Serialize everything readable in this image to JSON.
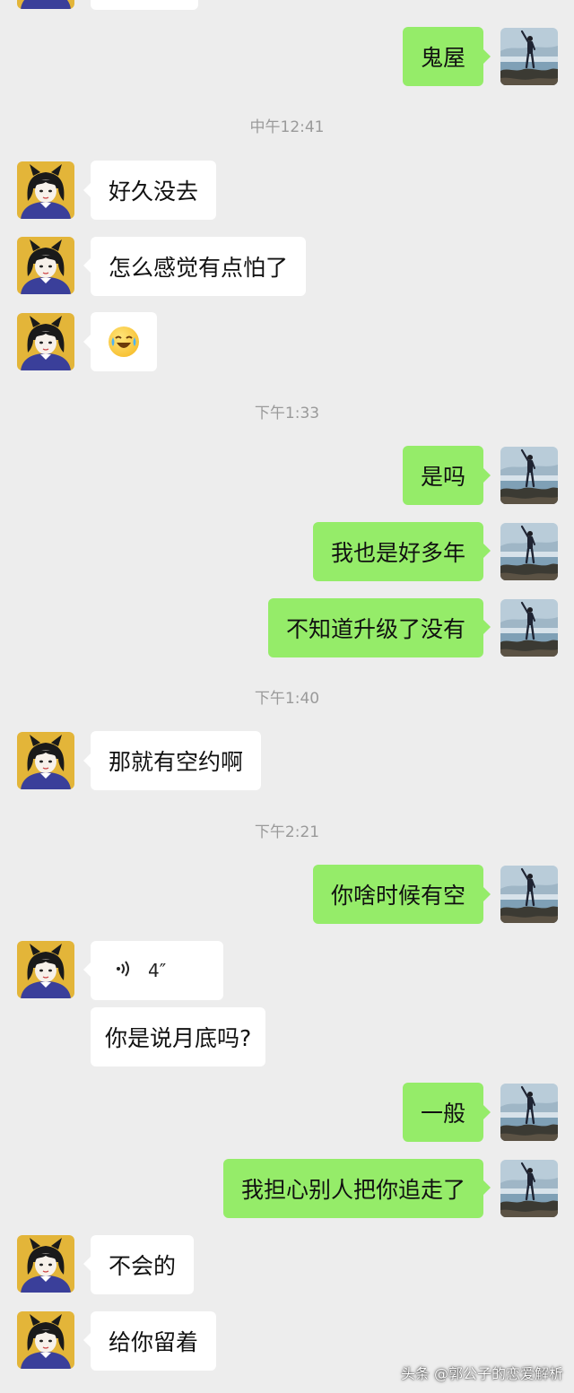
{
  "timestamps": [
    "中午12:41",
    "下午1:33",
    "下午1:40",
    "下午2:21"
  ],
  "messages": {
    "m0": "鬼屋",
    "m1": "好久没去",
    "m2": "怎么感觉有点怕了",
    "m3": "是吗",
    "m4": "我也是好多年",
    "m5": "不知道升级了没有",
    "m6": "那就有空约啊",
    "m7": "你啥时候有空",
    "m8_voice_duration": "4″",
    "m9": "你是说月底吗?",
    "m10": "一般",
    "m11": "我担心别人把你追走了",
    "m12": "不会的",
    "m13": "给你留着"
  },
  "emoji": "crying-laughing-emoji",
  "voice_icon": "voice-wave-icon",
  "colors": {
    "background": "#ededed",
    "outgoing_bubble": "#95ec69",
    "incoming_bubble": "#ffffff",
    "timestamp_text": "#9a9a9a"
  },
  "watermark": "头条 @郭公子的恋爱解析"
}
